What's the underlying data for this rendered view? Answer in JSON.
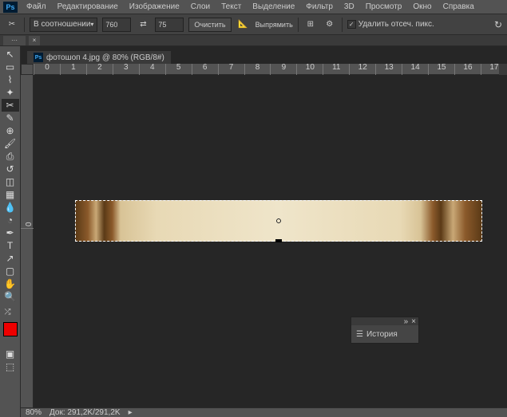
{
  "menu": {
    "items": [
      "Файл",
      "Редактирование",
      "Изображение",
      "Слои",
      "Текст",
      "Выделение",
      "Фильтр",
      "3D",
      "Просмотр",
      "Окно",
      "Справка"
    ]
  },
  "options": {
    "ratio_label": "В соотношении",
    "width": "760",
    "height": "75",
    "clear": "Очистить",
    "straighten": "Выпрямить",
    "delete_crop": "Удалить отсеч. пикс."
  },
  "tab_short": "···",
  "doc": {
    "title": "фотошоп 4.jpg @ 80% (RGB/8#)",
    "ps": "Ps"
  },
  "ruler_h": [
    "0",
    "1",
    "2",
    "3",
    "4",
    "5",
    "6",
    "7",
    "8",
    "9",
    "10",
    "11",
    "12",
    "13",
    "14",
    "15",
    "16",
    "17"
  ],
  "ruler_v": [
    "0"
  ],
  "status": {
    "zoom": "80%",
    "doc_info": "Док: 291,2K/291,2K"
  },
  "panel": {
    "title": "История",
    "collapse": "»",
    "close": "×"
  },
  "reset_icon": "↻"
}
